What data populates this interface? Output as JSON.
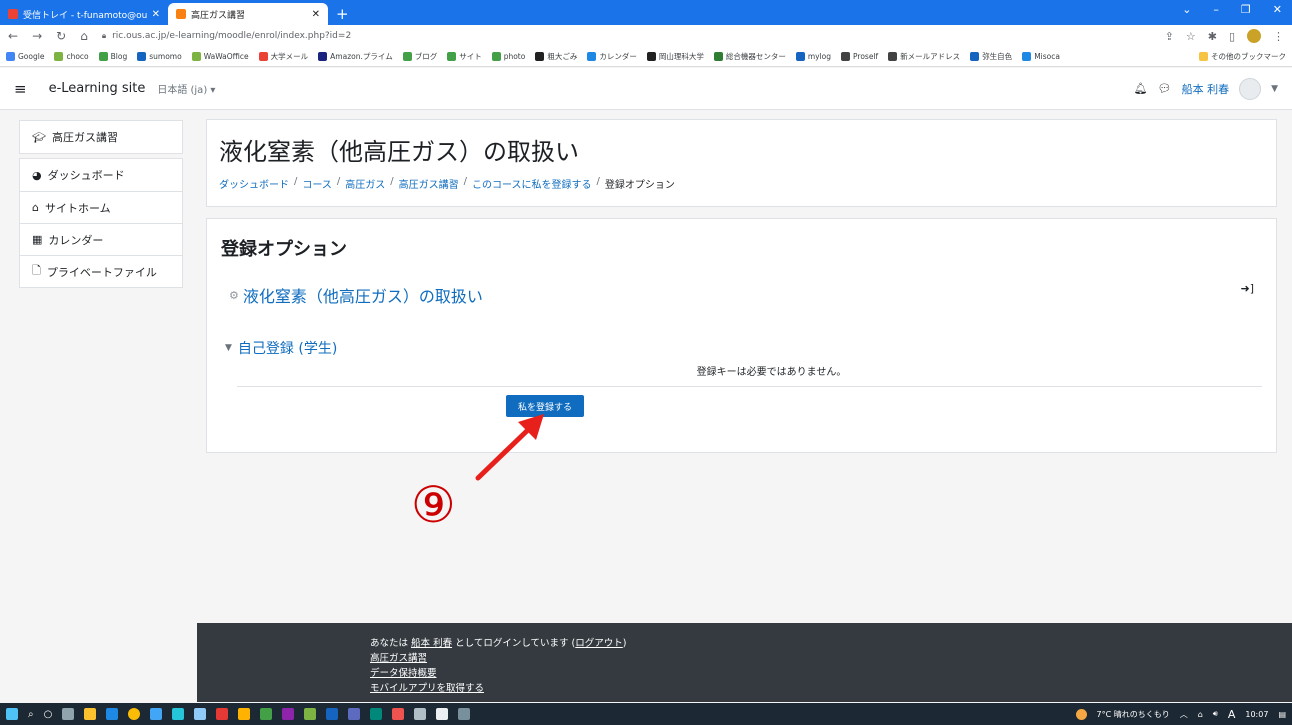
{
  "browser": {
    "tabs": [
      {
        "title": "受信トレイ - t-funamoto@ous.ac.j",
        "active": false,
        "favicon_color": "#ea4335"
      },
      {
        "title": "高圧ガス講習",
        "active": true,
        "favicon_color": "#f98012"
      }
    ],
    "new_tab_label": "+",
    "url": "ric.ous.ac.jp/e-learning/moodle/enrol/index.php?id=2",
    "bookmarks": [
      {
        "label": "Google",
        "color": "#4285f4"
      },
      {
        "label": "choco",
        "color": "#7cb342"
      },
      {
        "label": "Blog",
        "color": "#43a047"
      },
      {
        "label": "sumomo",
        "color": "#1565c0"
      },
      {
        "label": "WaWaOffice",
        "color": "#7cb342"
      },
      {
        "label": "大学メール",
        "color": "#ea4335"
      },
      {
        "label": "Amazon.プライム",
        "color": "#1a237e"
      },
      {
        "label": "ブログ",
        "color": "#43a047"
      },
      {
        "label": "サイト",
        "color": "#43a047"
      },
      {
        "label": "photo",
        "color": "#43a047"
      },
      {
        "label": "粗大ごみ",
        "color": "#212121"
      },
      {
        "label": "カレンダー",
        "color": "#1e88e5"
      },
      {
        "label": "岡山理科大学",
        "color": "#212121"
      },
      {
        "label": "総合機器センター",
        "color": "#2e7d32"
      },
      {
        "label": "mylog",
        "color": "#1565c0"
      },
      {
        "label": "Proself",
        "color": "#424242"
      },
      {
        "label": "新メールアドレス",
        "color": "#424242"
      },
      {
        "label": "弥生自色",
        "color": "#1565c0"
      },
      {
        "label": "Misoca",
        "color": "#1e88e5"
      }
    ],
    "other_bookmarks": "その他のブックマーク"
  },
  "navbar": {
    "site_name": "e-Learning site",
    "language": "日本語 (ja) ▾",
    "user_name": "船本 利春"
  },
  "sidebar": {
    "course": "高圧ガス講習",
    "items": [
      "ダッシュボード",
      "サイトホーム",
      "カレンダー",
      "プライベートファイル"
    ]
  },
  "header": {
    "title": "液化窒素（他高圧ガス）の取扱い",
    "breadcrumb": [
      "ダッシュボード",
      "コース",
      "高圧ガス",
      "高圧ガス講習",
      "このコースに私を登録する",
      "登録オプション"
    ]
  },
  "main": {
    "heading": "登録オプション",
    "course_link": "液化窒素（他高圧ガス）の取扱い",
    "self_enrol_heading": "自己登録 (学生)",
    "no_key_text": "登録キーは必要ではありません。",
    "enrol_button": "私を登録する"
  },
  "annotation": {
    "number": "⑨",
    "color": "#cc0000"
  },
  "footer": {
    "login_prefix": "あなたは",
    "login_user": "船本 利春",
    "login_middle": "としてログインしています (",
    "logout": "ログアウト",
    "login_suffix": ")",
    "links": [
      "高圧ガス講習",
      "データ保持概要",
      "モバイルアプリを取得する"
    ]
  },
  "taskbar": {
    "weather": "7°C 晴れのちくもり",
    "ime": "A",
    "time": "10:07"
  },
  "colors": {
    "accent": "#0f6cbf",
    "chrome_blue": "#1a73e8",
    "footer_bg": "#343a40"
  }
}
